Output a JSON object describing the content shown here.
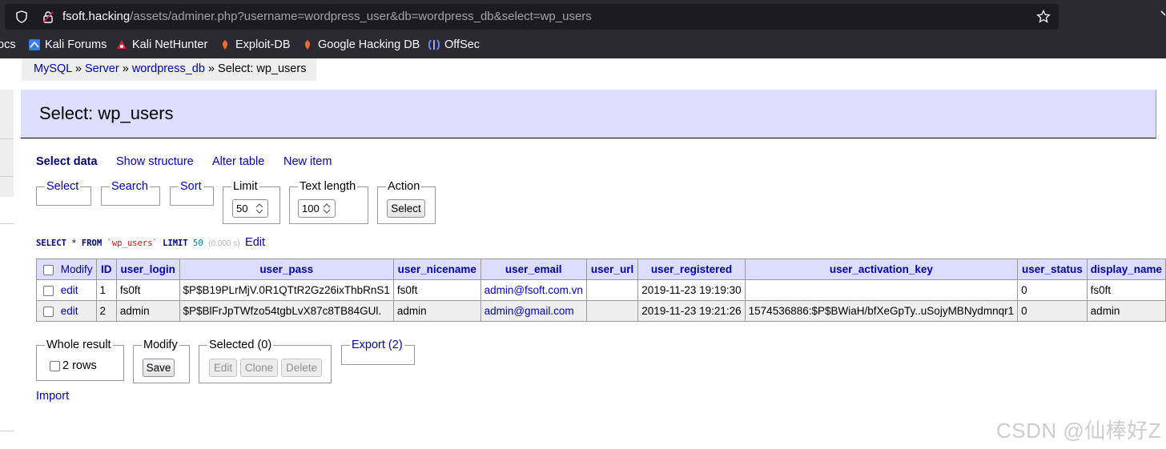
{
  "browser": {
    "url_host": "fsoft.hacking",
    "url_path": "/assets/adminer.php?username=wordpress_user&db=wordpress_db&select=wp_users",
    "bookmarks": [
      "ocs",
      "Kali Forums",
      "Kali NetHunter",
      "Exploit-DB",
      "Google Hacking DB",
      "OffSec"
    ]
  },
  "breadcrumb": {
    "items": [
      "MySQL",
      "Server",
      "wordpress_db"
    ],
    "separator": "»",
    "current": "Select: wp_users"
  },
  "page": {
    "title": "Select: wp_users"
  },
  "menu": {
    "select_data": "Select data",
    "show_structure": "Show structure",
    "alter_table": "Alter table",
    "new_item": "New item"
  },
  "filters": {
    "select": "Select",
    "search": "Search",
    "sort": "Sort",
    "limit_legend": "Limit",
    "limit_value": "50",
    "text_length_legend": "Text length",
    "text_length_value": "100",
    "action_legend": "Action",
    "action_button": "Select"
  },
  "query": {
    "select_kw": "SELECT",
    "star": " * ",
    "from_kw": "FROM",
    "table": "`wp_users`",
    "limit_kw": "LIMIT",
    "limit": "50",
    "time": "(0.000 s)",
    "edit": "Edit"
  },
  "table": {
    "modify_header": "Modify",
    "columns": [
      "ID",
      "user_login",
      "user_pass",
      "user_nicename",
      "user_email",
      "user_url",
      "user_registered",
      "user_activation_key",
      "user_status",
      "display_name"
    ],
    "rows": [
      {
        "action": "edit",
        "cells": [
          "1",
          "fs0ft",
          "$P$B19PLrMjV.0R1QTtR2Gz26ixThbRnS1",
          "fs0ft",
          "admin@fsoft.com.vn",
          "",
          "2019-11-23 19:19:30",
          "",
          "0",
          "fs0ft"
        ]
      },
      {
        "action": "edit",
        "cells": [
          "2",
          "admin",
          "$P$BlFrJpTWfzo54tgbLvX87c8TB84GUl.",
          "admin",
          "admin@gmail.com",
          "",
          "2019-11-23 19:21:26",
          "1574536886:$P$BWiaH/bfXeGpTy..uSojyMBNydmnqr1",
          "0",
          "admin"
        ]
      }
    ]
  },
  "bottom": {
    "whole_result_legend": "Whole result",
    "rows_label": "2 rows",
    "modify_legend": "Modify",
    "save_button": "Save",
    "selected_legend": "Selected (0)",
    "edit_button": "Edit",
    "clone_button": "Clone",
    "delete_button": "Delete",
    "export_legend": "Export (2)",
    "import_link": "Import"
  },
  "watermark": "CSDN @仙棒好Z"
}
